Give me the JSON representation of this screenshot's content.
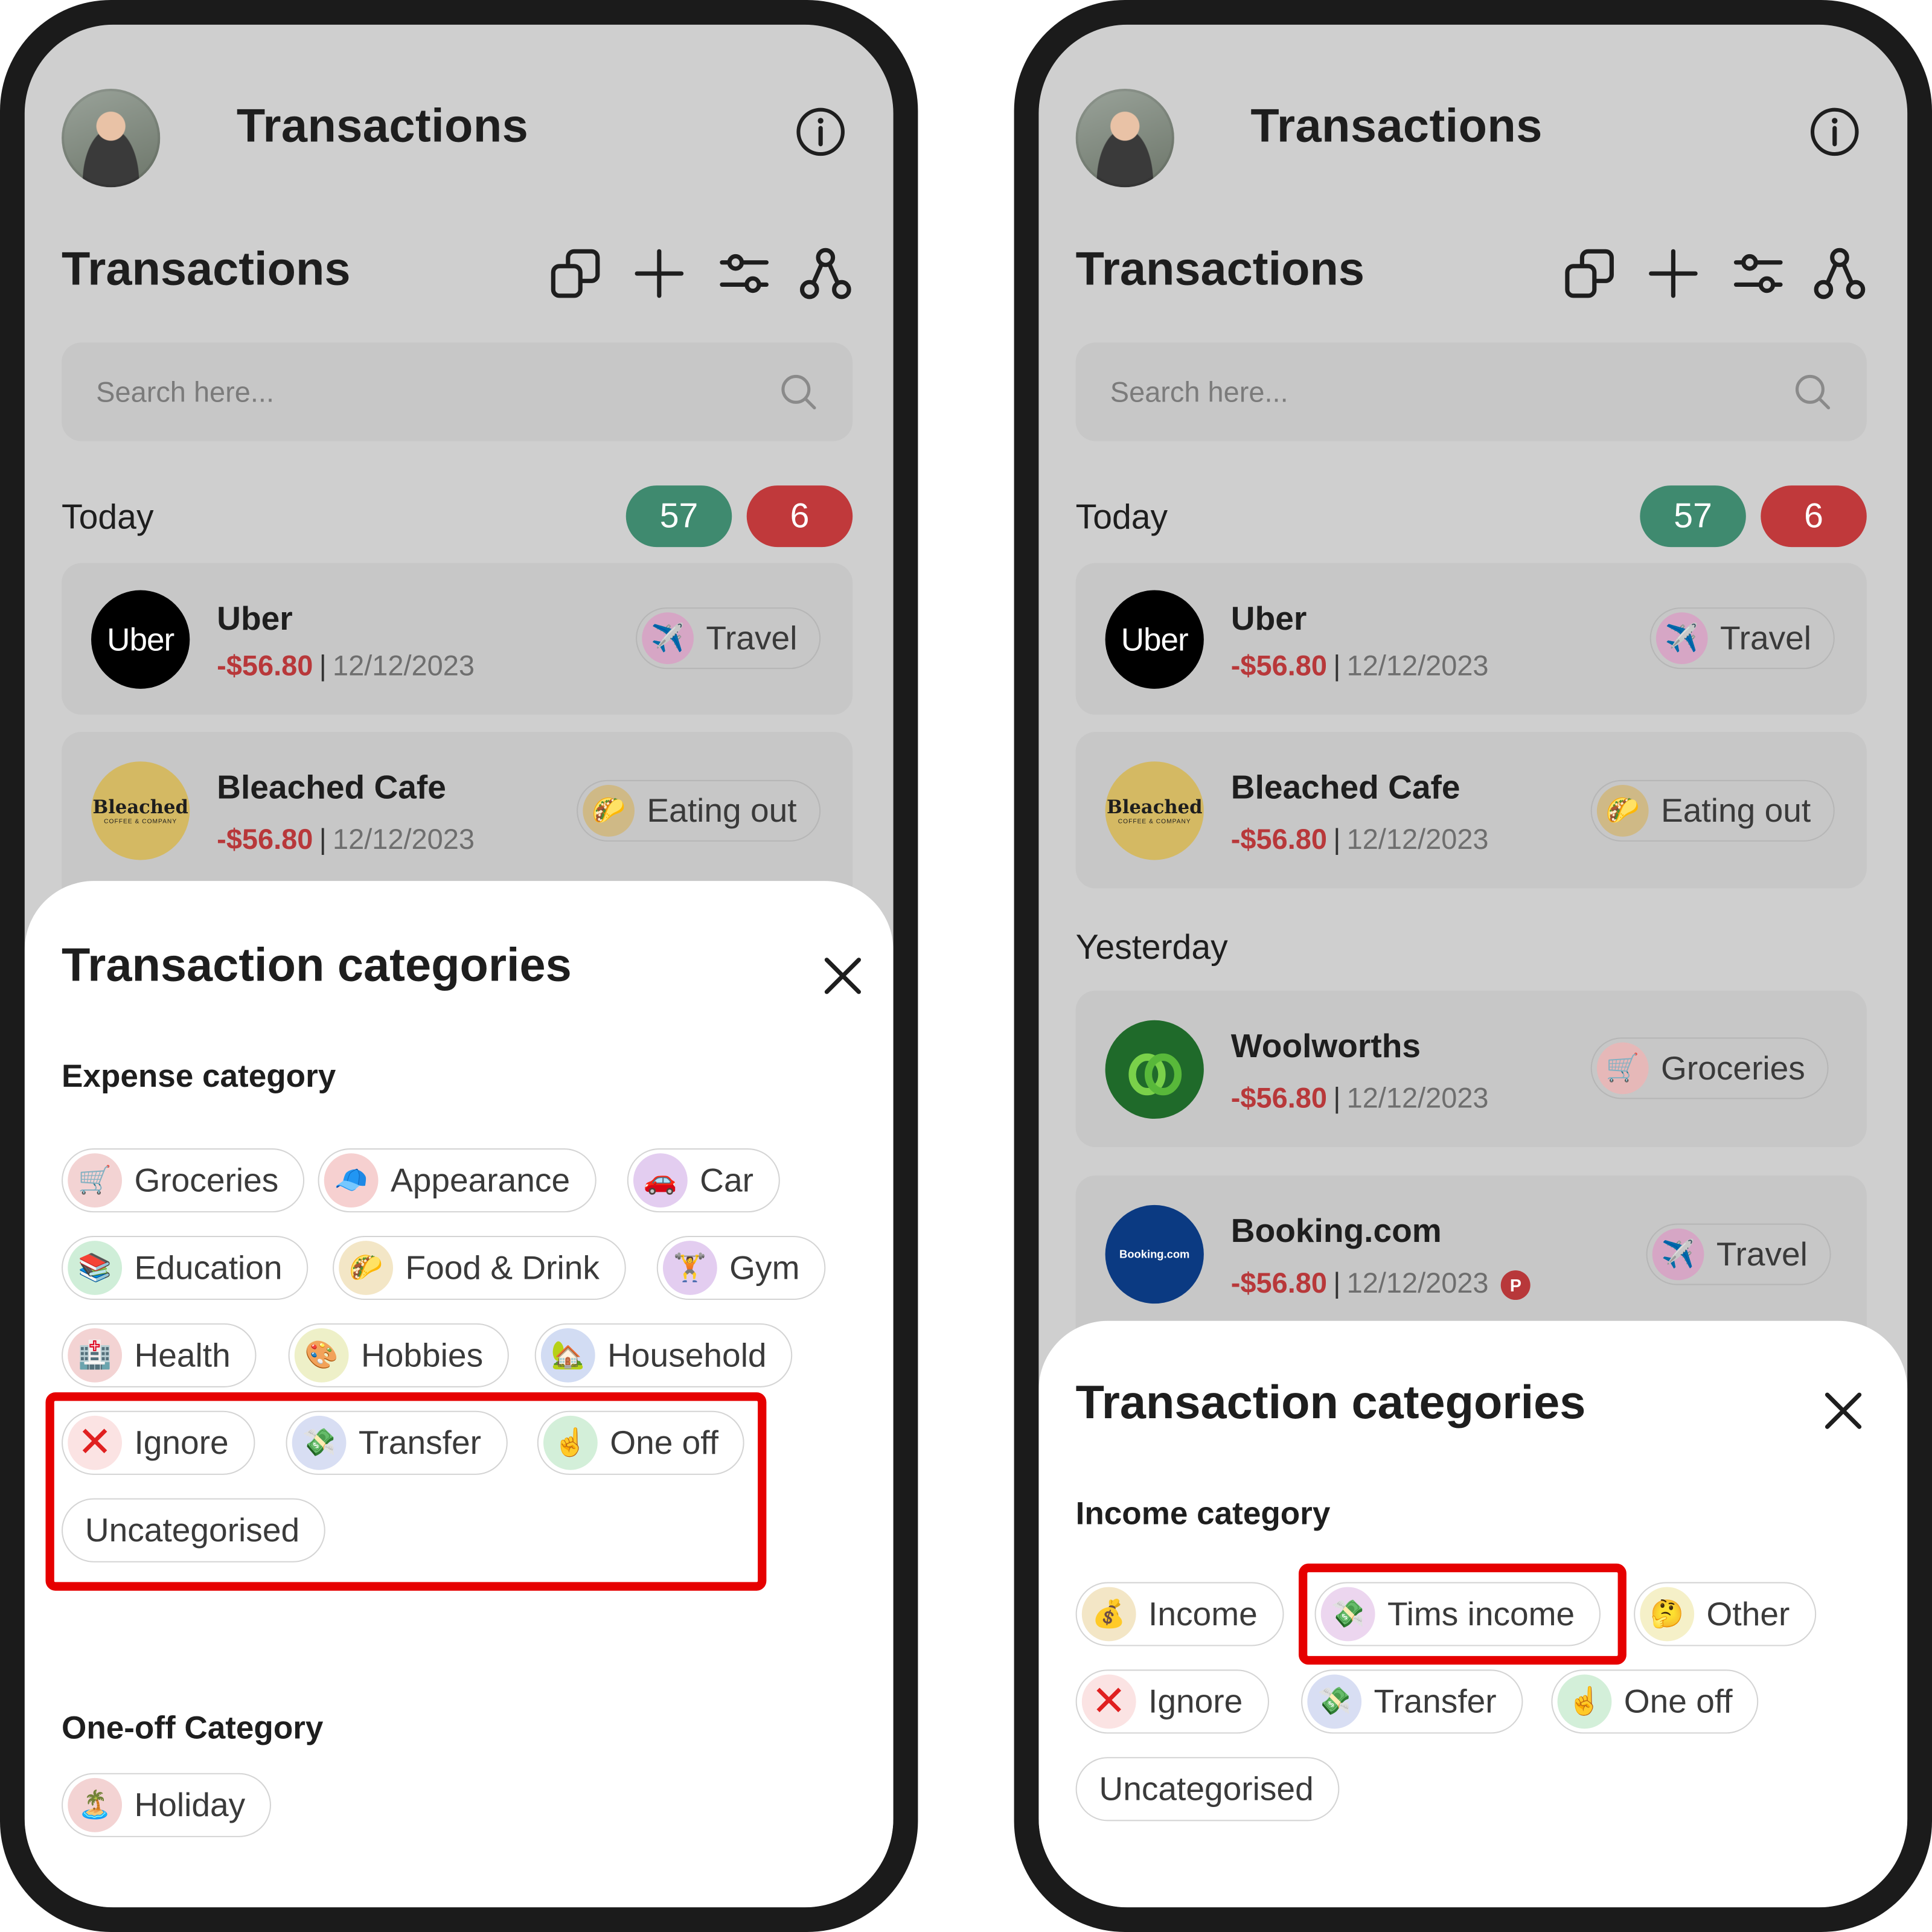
{
  "colors": {
    "positive_badge": "#3f8a6f",
    "negative_badge": "#c0393b",
    "amount": "#b8383a",
    "highlight": "#e60000"
  },
  "screens": [
    {
      "header": {
        "title": "Transactions",
        "info_icon": "info-icon"
      },
      "section_title": "Transactions",
      "toolbar": [
        "copy-icon",
        "plus-icon",
        "sliders-icon",
        "share-nodes-icon"
      ],
      "search": {
        "placeholder": "Search here..."
      },
      "today": {
        "label": "Today",
        "positive_count": "57",
        "negative_count": "6"
      },
      "transactions": [
        {
          "logo_text": "Uber",
          "merchant": "Uber",
          "amount": "-$56.80",
          "sep": "|",
          "date": "12/12/2023",
          "category": "Travel",
          "emoji": "✈️"
        },
        {
          "logo_text": "Bleached",
          "logo_sub": "COFFEE & COMPANY",
          "merchant": "Bleached Cafe",
          "amount": "-$56.80",
          "sep": "|",
          "date": "12/12/2023",
          "category": "Eating out",
          "emoji": "🌮"
        }
      ],
      "sheet": {
        "title": "Transaction categories",
        "groups": [
          {
            "label": "Expense category",
            "chips": [
              {
                "label": "Groceries",
                "emoji": "🛒"
              },
              {
                "label": "Appearance",
                "emoji": "🧢"
              },
              {
                "label": "Car",
                "emoji": "🚗"
              },
              {
                "label": "Education",
                "emoji": "📚"
              },
              {
                "label": "Food & Drink",
                "emoji": "🌮"
              },
              {
                "label": "Gym",
                "emoji": "🏋️"
              },
              {
                "label": "Health",
                "emoji": "🏥"
              },
              {
                "label": "Hobbies",
                "emoji": "🎨"
              },
              {
                "label": "Household",
                "emoji": "🏡"
              },
              {
                "label": "Ignore",
                "emoji": "✕"
              },
              {
                "label": "Transfer",
                "emoji": "💸"
              },
              {
                "label": "One off",
                "emoji": "☝️"
              },
              {
                "label": "Uncategorised",
                "emoji": ""
              }
            ]
          },
          {
            "label": "One-off Category",
            "chips": [
              {
                "label": "Holiday",
                "emoji": "🏝️"
              }
            ]
          }
        ]
      }
    },
    {
      "header": {
        "title": "Transactions",
        "info_icon": "info-icon"
      },
      "section_title": "Transactions",
      "toolbar": [
        "copy-icon",
        "plus-icon",
        "sliders-icon",
        "share-nodes-icon"
      ],
      "search": {
        "placeholder": "Search here..."
      },
      "today": {
        "label": "Today",
        "positive_count": "57",
        "negative_count": "6"
      },
      "yesterday": {
        "label": "Yesterday"
      },
      "transactions": [
        {
          "logo_text": "Uber",
          "merchant": "Uber",
          "amount": "-$56.80",
          "sep": "|",
          "date": "12/12/2023",
          "category": "Travel",
          "emoji": "✈️"
        },
        {
          "logo_text": "Bleached",
          "logo_sub": "COFFEE & COMPANY",
          "merchant": "Bleached Cafe",
          "amount": "-$56.80",
          "sep": "|",
          "date": "12/12/2023",
          "category": "Eating out",
          "emoji": "🌮"
        },
        {
          "merchant": "Woolworths",
          "amount": "-$56.80",
          "sep": "|",
          "date": "12/12/2023",
          "category": "Groceries",
          "emoji": "🛒"
        },
        {
          "logo_text": "Booking.com",
          "merchant": "Booking.com",
          "amount": "-$56.80",
          "sep": "|",
          "date": "12/12/2023",
          "badge": "P",
          "category": "Travel",
          "emoji": "✈️"
        }
      ],
      "sheet": {
        "title": "Transaction categories",
        "groups": [
          {
            "label": "Income category",
            "chips": [
              {
                "label": "Income",
                "emoji": "💰"
              },
              {
                "label": "Tims income",
                "emoji": "💸"
              },
              {
                "label": "Other",
                "emoji": "🤔"
              },
              {
                "label": "Ignore",
                "emoji": "✕"
              },
              {
                "label": "Transfer",
                "emoji": "💸"
              },
              {
                "label": "One off",
                "emoji": "☝️"
              },
              {
                "label": "Uncategorised",
                "emoji": ""
              }
            ]
          }
        ]
      }
    }
  ]
}
